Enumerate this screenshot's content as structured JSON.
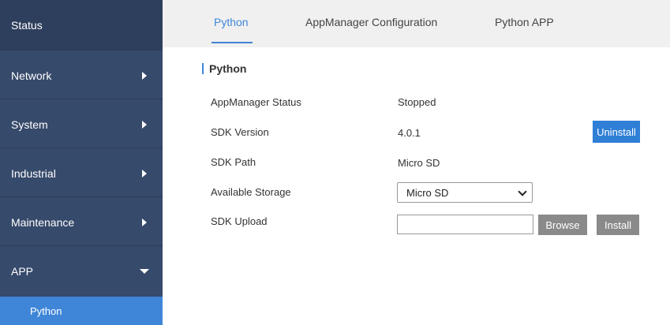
{
  "sidebar": {
    "items": [
      {
        "label": "Status"
      },
      {
        "label": "Network"
      },
      {
        "label": "System"
      },
      {
        "label": "Industrial"
      },
      {
        "label": "Maintenance"
      },
      {
        "label": "APP"
      }
    ],
    "sub_item": "Python"
  },
  "tabs": [
    {
      "label": "Python"
    },
    {
      "label": "AppManager Configuration"
    },
    {
      "label": "Python APP"
    }
  ],
  "section": {
    "title": "Python",
    "rows": [
      {
        "label": "AppManager Status",
        "value": "Stopped"
      },
      {
        "label": "SDK Version",
        "value": "4.0.1"
      },
      {
        "label": "SDK Path",
        "value": "Micro SD"
      },
      {
        "label": "Available Storage",
        "value": "Micro SD"
      },
      {
        "label": "SDK Upload",
        "value": ""
      }
    ],
    "uninstall_label": "Uninstall",
    "browse_label": "Browse",
    "install_label": "Install"
  }
}
